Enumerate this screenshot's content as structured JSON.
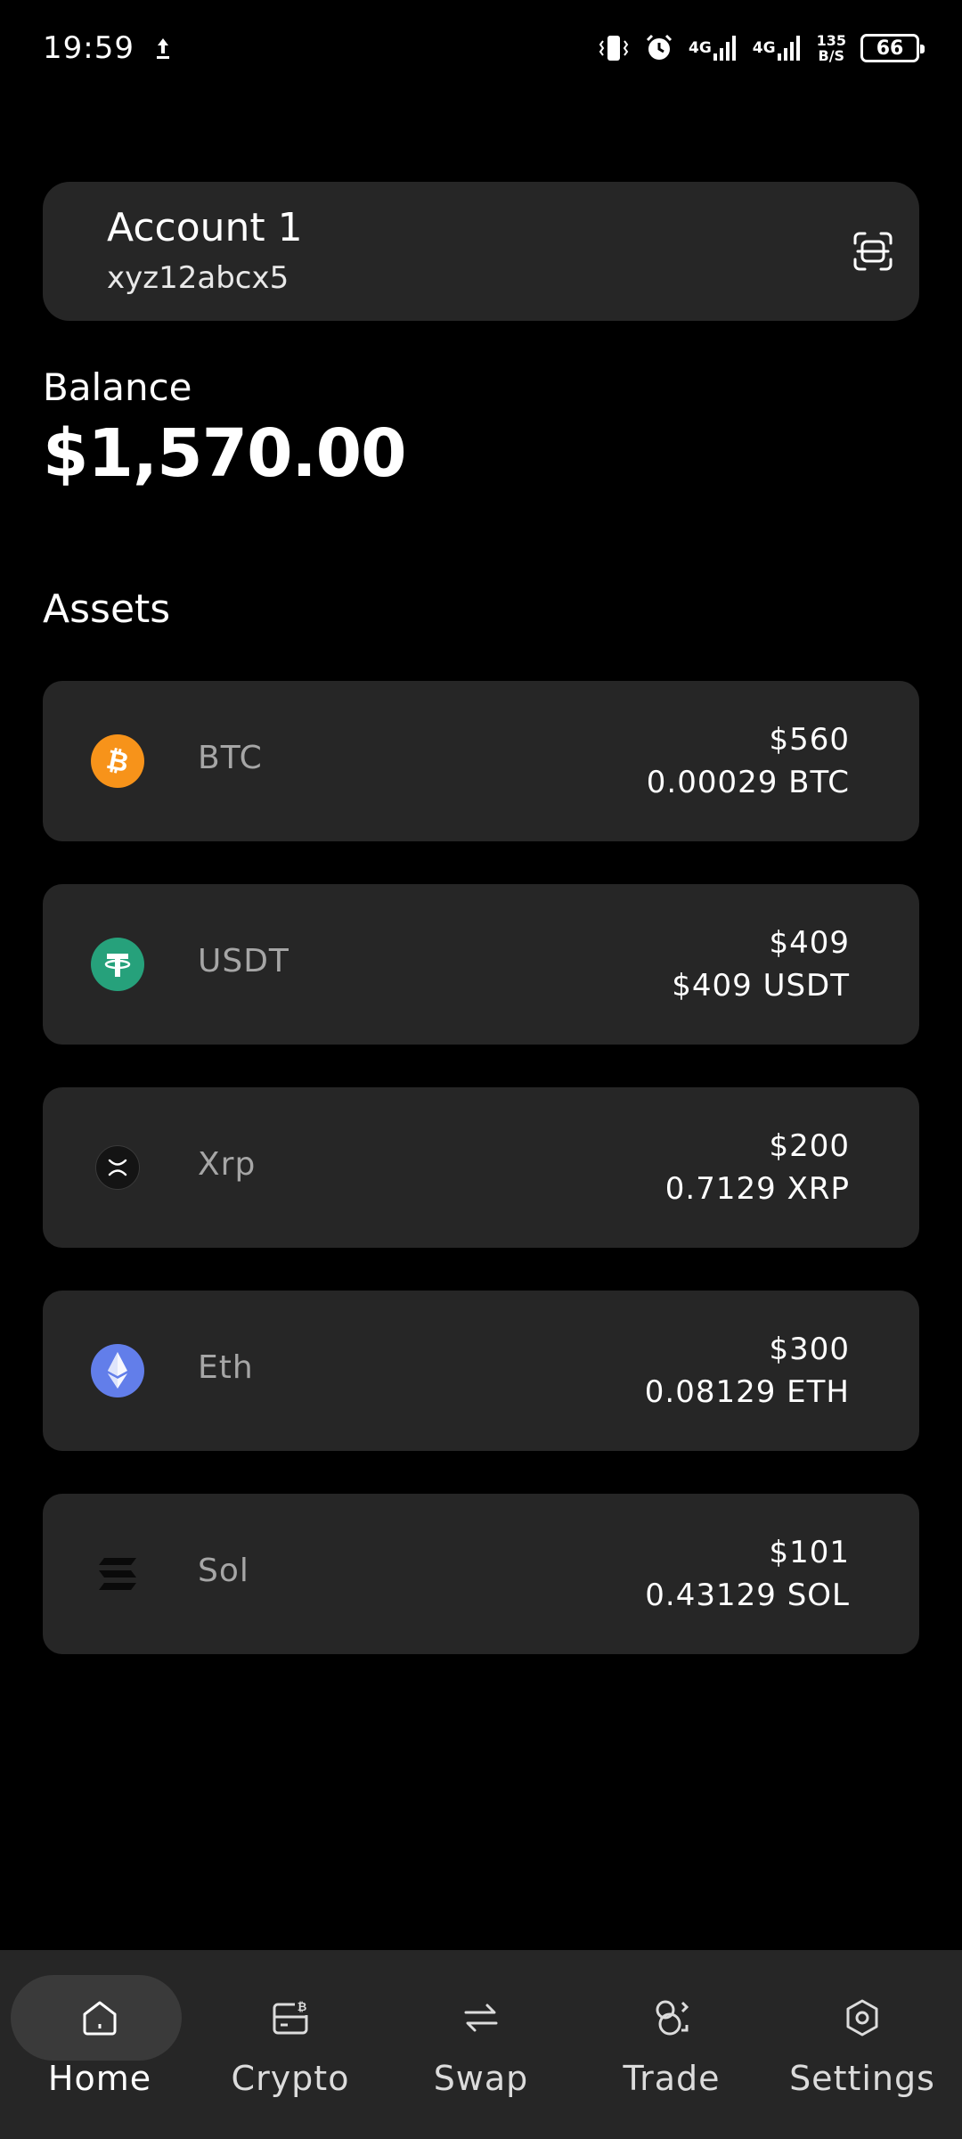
{
  "status_bar": {
    "time": "19:59",
    "network_1": "4G",
    "network_2": "4G",
    "speed_value": "135",
    "speed_unit": "B/S",
    "battery": "66",
    "icons": [
      "upload-icon",
      "vibrate-icon",
      "alarm-icon",
      "signal-icon",
      "signal-icon"
    ]
  },
  "account": {
    "name": "Account 1",
    "address": "xyz12abcx5",
    "scan_icon": "scan-icon"
  },
  "balance": {
    "label": "Balance",
    "value": "$1,570.00"
  },
  "assets": {
    "title": "Assets",
    "items": [
      {
        "name": "BTC",
        "usd": "$560",
        "amount": "0.00029 BTC",
        "icon": "bitcoin-icon",
        "color": "#F7931A"
      },
      {
        "name": "USDT",
        "usd": "$409",
        "amount": "$409 USDT",
        "icon": "tether-icon",
        "color": "#26A17B"
      },
      {
        "name": "Xrp",
        "usd": "$200",
        "amount": "0.7129 XRP",
        "icon": "xrp-icon",
        "color": "#1a1a1a"
      },
      {
        "name": "Eth",
        "usd": "$300",
        "amount": "0.08129 ETH",
        "icon": "ethereum-icon",
        "color": "#627EEA"
      },
      {
        "name": "Sol",
        "usd": "$101",
        "amount": "0.43129 SOL",
        "icon": "solana-icon",
        "color": "#000000"
      }
    ]
  },
  "nav": {
    "active": "Home",
    "items": [
      {
        "label": "Home",
        "icon": "home-icon"
      },
      {
        "label": "Crypto",
        "icon": "wallet-icon"
      },
      {
        "label": "Swap",
        "icon": "swap-icon"
      },
      {
        "label": "Trade",
        "icon": "trade-icon"
      },
      {
        "label": "Settings",
        "icon": "settings-icon"
      }
    ]
  }
}
